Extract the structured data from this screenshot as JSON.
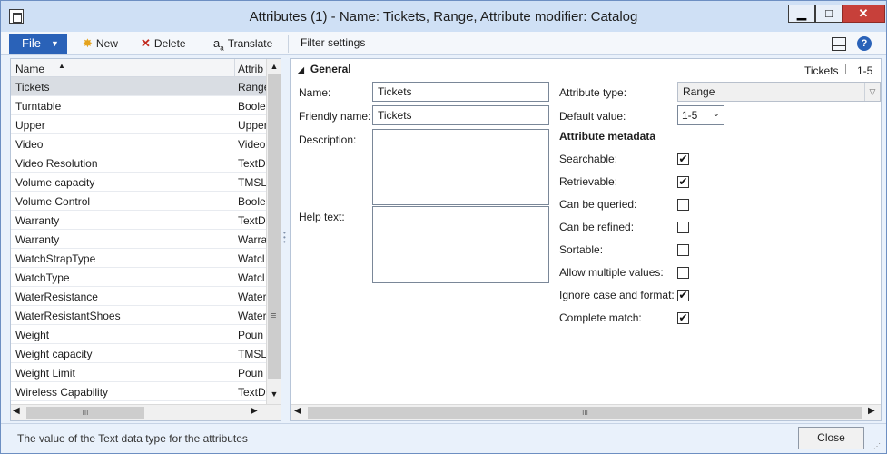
{
  "window": {
    "title": "Attributes (1) - Name: Tickets, Range, Attribute modifier: Catalog",
    "minimize": "▁",
    "maximize": "□",
    "close": "✕"
  },
  "toolbar": {
    "file_label": "File",
    "new_label": "New",
    "delete_label": "Delete",
    "translate_label": "Translate",
    "filter_label": "Filter settings",
    "help_label": "?"
  },
  "grid": {
    "columns": [
      "Name",
      "Attrib"
    ],
    "rows": [
      {
        "name": "Tickets",
        "attr": "Range",
        "selected": true
      },
      {
        "name": "Turntable",
        "attr": "Boole"
      },
      {
        "name": "Upper",
        "attr": "Upper"
      },
      {
        "name": "Video",
        "attr": "Video"
      },
      {
        "name": "Video Resolution",
        "attr": "TextD"
      },
      {
        "name": "Volume capacity",
        "attr": "TMSL"
      },
      {
        "name": "Volume Control",
        "attr": "Boole"
      },
      {
        "name": "Warranty",
        "attr": "TextD"
      },
      {
        "name": "Warranty",
        "attr": "Warra"
      },
      {
        "name": "WatchStrapType",
        "attr": "Watcl"
      },
      {
        "name": "WatchType",
        "attr": "Watcl"
      },
      {
        "name": "WaterResistance",
        "attr": "Water"
      },
      {
        "name": "WaterResistantShoes",
        "attr": "Water"
      },
      {
        "name": "Weight",
        "attr": "Poun"
      },
      {
        "name": "Weight capacity",
        "attr": "TMSL"
      },
      {
        "name": "Weight Limit",
        "attr": "Poun"
      },
      {
        "name": "Wireless Capability",
        "attr": "TextD"
      }
    ]
  },
  "details": {
    "section_title": "General",
    "record_name": "Tickets",
    "record_value": "1-5",
    "name_label": "Name:",
    "name_value": "Tickets",
    "friendly_label": "Friendly name:",
    "friendly_value": "Tickets",
    "description_label": "Description:",
    "help_label": "Help text:",
    "attribute_type_label": "Attribute type:",
    "attribute_type_value": "Range",
    "default_value_label": "Default value:",
    "default_value": "1-5",
    "metadata_title": "Attribute metadata",
    "metadata": [
      {
        "label": "Searchable:",
        "checked": true
      },
      {
        "label": "Retrievable:",
        "checked": true
      },
      {
        "label": "Can be queried:",
        "checked": false
      },
      {
        "label": "Can be refined:",
        "checked": false
      },
      {
        "label": "Sortable:",
        "checked": false
      },
      {
        "label": "Allow multiple values:",
        "checked": false
      },
      {
        "label": "Ignore case and format:",
        "checked": true
      },
      {
        "label": "Complete match:",
        "checked": true
      }
    ]
  },
  "status": {
    "text": "The value of the Text data type for the attributes",
    "close_label": "Close"
  }
}
